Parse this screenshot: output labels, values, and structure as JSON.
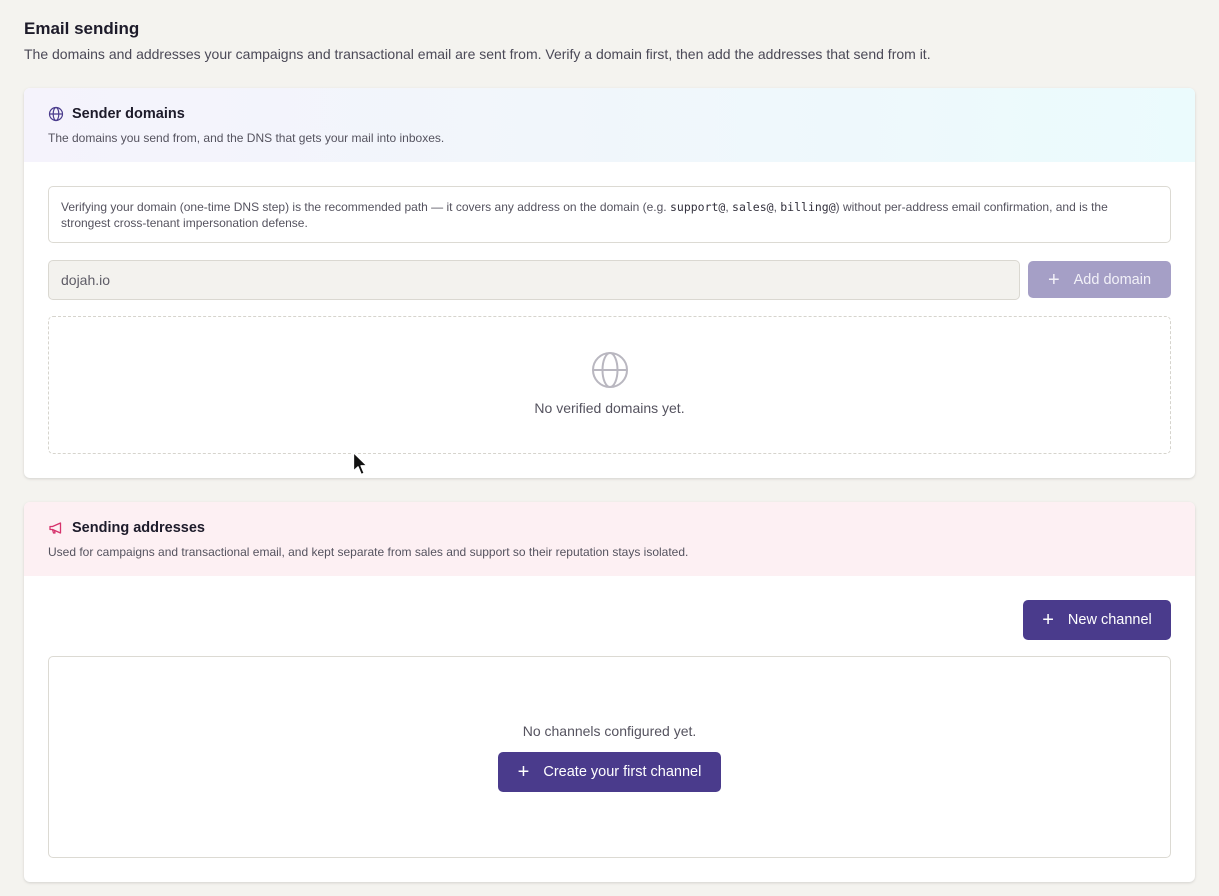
{
  "page": {
    "title": "Email sending",
    "subtitle": "The domains and addresses your campaigns and transactional email are sent from. Verify a domain first, then add the addresses that send from it."
  },
  "sender_domains": {
    "icon": "globe-icon",
    "title": "Sender domains",
    "description": "The domains you send from, and the DNS that gets your mail into inboxes.",
    "info": {
      "text_1": "Verifying your domain (one-time DNS step) is the recommended path — it covers any address on the domain (e.g. ",
      "code_1": "support@",
      "sep_1": ", ",
      "code_2": "sales@",
      "sep_2": ", ",
      "code_3": "billing@",
      "text_2": ") without per-address email confirmation, and is the strongest cross-tenant impersonation defense."
    },
    "input_value": "dojah.io",
    "add_button": "Add domain",
    "empty_text": "No verified domains yet."
  },
  "sending_addresses": {
    "icon": "megaphone-icon",
    "title": "Sending addresses",
    "description": "Used for campaigns and transactional email, and kept separate from sales and support so their reputation stays isolated.",
    "new_button": "New channel",
    "empty_text": "No channels configured yet.",
    "create_button": "Create your first channel"
  },
  "colors": {
    "accent": "#4a3b8c",
    "accent_disabled": "#a59fc6",
    "background": "#f4f3ef",
    "megaphone": "#d6336c"
  }
}
